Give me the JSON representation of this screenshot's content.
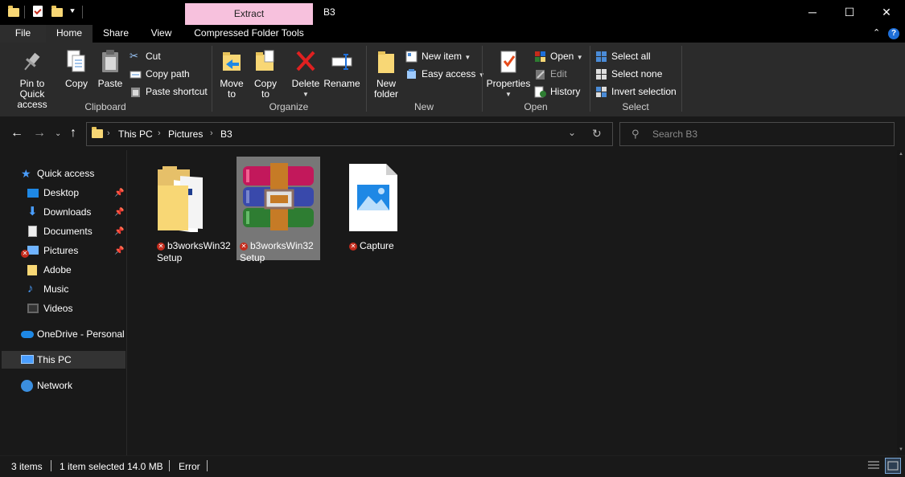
{
  "window": {
    "title": "B3",
    "context_tab": "Extract",
    "minimize": "─",
    "maximize": "☐",
    "close": "✕"
  },
  "ribbon_tabs": [
    "File",
    "Home",
    "Share",
    "View",
    "Compressed Folder Tools"
  ],
  "ribbon": {
    "clipboard": {
      "label": "Clipboard",
      "pin": "Pin to Quick access",
      "copy": "Copy",
      "paste": "Paste",
      "cut": "Cut",
      "copy_path": "Copy path",
      "paste_shortcut": "Paste shortcut"
    },
    "organize": {
      "label": "Organize",
      "move_to": "Move to",
      "copy_to": "Copy to",
      "delete": "Delete",
      "rename": "Rename"
    },
    "new": {
      "label": "New",
      "new_folder": "New folder",
      "new_item": "New item",
      "easy_access": "Easy access"
    },
    "open": {
      "label": "Open",
      "properties": "Properties",
      "open": "Open",
      "edit": "Edit",
      "history": "History"
    },
    "select": {
      "label": "Select",
      "select_all": "Select all",
      "select_none": "Select none",
      "invert_selection": "Invert selection"
    }
  },
  "address": {
    "breadcrumbs": [
      "This PC",
      "Pictures",
      "B3"
    ],
    "search_placeholder": "Search B3"
  },
  "sidebar": {
    "quick_access": "Quick access",
    "items": [
      {
        "label": "Desktop",
        "pinned": true
      },
      {
        "label": "Downloads",
        "pinned": true
      },
      {
        "label": "Documents",
        "pinned": true
      },
      {
        "label": "Pictures",
        "pinned": true
      },
      {
        "label": "Adobe",
        "pinned": false
      },
      {
        "label": "Music",
        "pinned": false
      },
      {
        "label": "Videos",
        "pinned": false
      }
    ],
    "onedrive": "OneDrive - Personal",
    "this_pc": "This PC",
    "network": "Network"
  },
  "files": [
    {
      "name_line1": "b3worksWin32",
      "name_line2": "Setup",
      "type": "folder",
      "selected": false,
      "error": true
    },
    {
      "name_line1": "b3worksWin32",
      "name_line2": "Setup",
      "type": "archive",
      "selected": true,
      "error": true
    },
    {
      "name_line1": "Capture",
      "name_line2": "",
      "type": "image",
      "selected": false,
      "error": true
    }
  ],
  "status": {
    "count": "3 items",
    "selection": "1 item selected",
    "size": "14.0 MB",
    "state": "Error"
  },
  "colors": {
    "extract_tab": "#f7c1dd",
    "background": "#191919",
    "ribbon": "#2b2b2b",
    "selected_item": "#777777",
    "error": "#c42b1c"
  }
}
